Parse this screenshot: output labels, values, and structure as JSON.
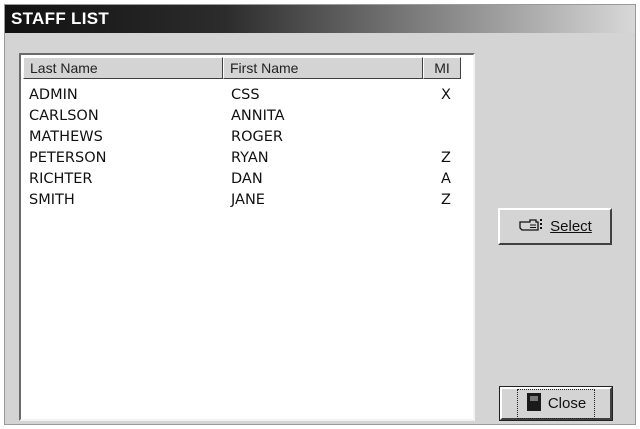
{
  "window": {
    "title": "STAFF LIST"
  },
  "table": {
    "columns": [
      "Last Name",
      "First Name",
      "MI"
    ],
    "rows": [
      {
        "last": "ADMIN",
        "first": "CSS",
        "mi": "X"
      },
      {
        "last": "CARLSON",
        "first": "ANNITA",
        "mi": ""
      },
      {
        "last": "MATHEWS",
        "first": "ROGER",
        "mi": ""
      },
      {
        "last": "PETERSON",
        "first": "RYAN",
        "mi": "Z"
      },
      {
        "last": "RICHTER",
        "first": "DAN",
        "mi": "A"
      },
      {
        "last": "SMITH",
        "first": "JANE",
        "mi": "Z"
      }
    ]
  },
  "buttons": {
    "select_label": "Select",
    "select_icon": "pointing-hand-icon",
    "close_label": "Close",
    "close_icon": "door-icon"
  }
}
